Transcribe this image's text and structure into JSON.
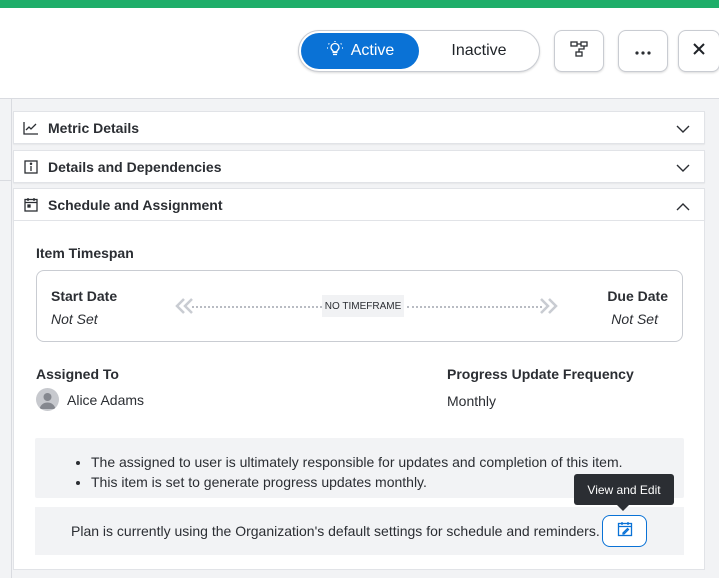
{
  "header": {
    "toggle": {
      "active_label": "Active",
      "inactive_label": "Inactive",
      "selected": "Active"
    },
    "buttons": {
      "tree": "hierarchy-icon",
      "more": "more-icon",
      "close": "close-icon"
    }
  },
  "panels": [
    {
      "label": "Metric Details",
      "icon": "chart-line-icon",
      "expanded": false
    },
    {
      "label": "Details and Dependencies",
      "icon": "info-icon",
      "expanded": false
    },
    {
      "label": "Schedule and Assignment",
      "icon": "calendar-icon",
      "expanded": true
    }
  ],
  "schedule": {
    "timespan_title": "Item Timespan",
    "start_label": "Start Date",
    "start_value": "Not Set",
    "due_label": "Due Date",
    "due_value": "Not Set",
    "timeframe_badge": "NO TIMEFRAME",
    "assigned_label": "Assigned To",
    "assigned_value": "Alice Adams",
    "frequency_label": "Progress Update Frequency",
    "frequency_value": "Monthly",
    "notes": [
      "The assigned to user is ultimately responsible for updates and completion of this item.",
      "This item is set to generate progress updates monthly."
    ],
    "settings_text": "Plan is currently using the Organization's default settings for schedule and reminders.",
    "tooltip": "View and Edit"
  },
  "colors": {
    "accent": "#0a72d6",
    "topbar": "#1fae6a"
  }
}
